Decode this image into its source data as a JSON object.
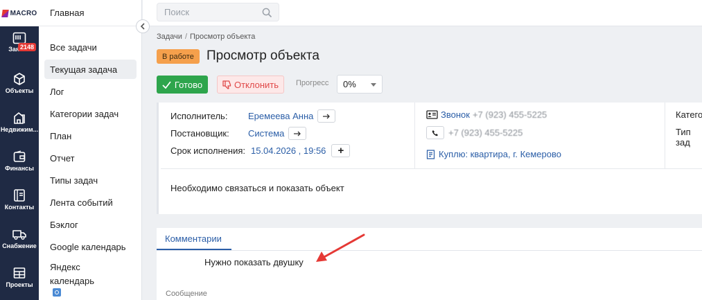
{
  "brand": {
    "name": "MACRO"
  },
  "rail": {
    "items": [
      {
        "label": "Заявки",
        "icon": "requests-icon",
        "badge": "2148"
      },
      {
        "label": "Объекты",
        "icon": "cube-icon"
      },
      {
        "label": "Недвижим...",
        "icon": "building-icon"
      },
      {
        "label": "Финансы",
        "icon": "wallet-icon"
      },
      {
        "label": "Контакты",
        "icon": "contacts-icon"
      },
      {
        "label": "Снабжение",
        "icon": "truck-icon"
      },
      {
        "label": "Проекты",
        "icon": "grid-icon"
      }
    ]
  },
  "sidebar": {
    "header": "Главная",
    "items": [
      {
        "label": "Все задачи"
      },
      {
        "label": "Текущая задача",
        "active": true
      },
      {
        "label": "Лог"
      },
      {
        "label": "Категории задач"
      },
      {
        "label": "План"
      },
      {
        "label": "Отчет"
      },
      {
        "label": "Типы задач"
      },
      {
        "label": "Лента событий"
      },
      {
        "label": "Бэклог"
      },
      {
        "label": "Google календарь"
      },
      {
        "label": "Яндекс календарь"
      }
    ]
  },
  "search": {
    "placeholder": "Поиск"
  },
  "breadcrumb": {
    "parent": "Задачи",
    "separator": "/",
    "current": "Просмотр объекта"
  },
  "task": {
    "status": "В работе",
    "title": "Просмотр объекта",
    "done_label": "Готово",
    "reject_label": "Отклонить",
    "progress_label": "Прогресс",
    "progress_value": "0%",
    "assignee_label": "Исполнитель:",
    "assignee": "Еремеева Анна",
    "creator_label": "Постановщик:",
    "creator": "Система",
    "deadline_label": "Срок исполнения:",
    "deadline": "15.04.2026 , 19:56",
    "call_label": "Звонок",
    "call_number": "+7 (923) 455-5225",
    "phone_number": "+7 (923) 455-5225",
    "deal_link": "Куплю: квартира, г. Кемерово",
    "category_label": "Категор",
    "type_label": "Тип зад",
    "description": "Необходимо связаться и показать объект"
  },
  "comments": {
    "tab_label": "Комментарии",
    "text": "Нужно показать двушку",
    "message_label": "Сообщение"
  },
  "colors": {
    "rail": "#1f2a44",
    "accent": "#2b5ea7",
    "done": "#2ea54c",
    "status": "#f5a04c",
    "reject": "#e04848",
    "annotation": "#e53935"
  }
}
